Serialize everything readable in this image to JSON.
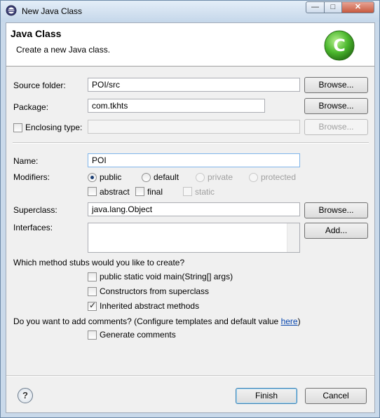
{
  "window": {
    "title": "New Java Class",
    "controls": {
      "minimize": "—",
      "maximize": "□",
      "close": "✕"
    }
  },
  "header": {
    "title": "Java Class",
    "description": "Create a new Java class.",
    "logo_letter": "C"
  },
  "form": {
    "source_folder": {
      "label": "Source folder:",
      "value": "POI/src",
      "browse": "Browse..."
    },
    "package": {
      "label": "Package:",
      "value": "com.tkhts",
      "browse": "Browse..."
    },
    "enclosing_type": {
      "label": "Enclosing type:",
      "value": "",
      "browse": "Browse...",
      "checked": false
    },
    "name": {
      "label": "Name:",
      "value": "POI"
    },
    "modifiers": {
      "label": "Modifiers:",
      "access": [
        "public",
        "default",
        "private",
        "protected"
      ],
      "selected_access": "public",
      "other": [
        {
          "label": "abstract",
          "checked": false,
          "enabled": true
        },
        {
          "label": "final",
          "checked": false,
          "enabled": true
        },
        {
          "label": "static",
          "checked": false,
          "enabled": false
        }
      ]
    },
    "superclass": {
      "label": "Superclass:",
      "value": "java.lang.Object",
      "browse": "Browse..."
    },
    "interfaces": {
      "label": "Interfaces:",
      "add": "Add..."
    },
    "stubs": {
      "question": "Which method stubs would you like to create?",
      "items": [
        {
          "label": "public static void main(String[] args)",
          "checked": false
        },
        {
          "label": "Constructors from superclass",
          "checked": false
        },
        {
          "label": "Inherited abstract methods",
          "checked": true
        }
      ]
    },
    "comments": {
      "question": "Do you want to add comments? (Configure templates and default value",
      "link": "here",
      "suffix": ")",
      "generate": {
        "label": "Generate comments",
        "checked": false
      }
    }
  },
  "footer": {
    "help": "?",
    "finish": "Finish",
    "cancel": "Cancel"
  },
  "colors": {
    "logo_green": "#4cb82e",
    "link": "#0645ad",
    "title_gradient_top": "#e4eef8"
  }
}
